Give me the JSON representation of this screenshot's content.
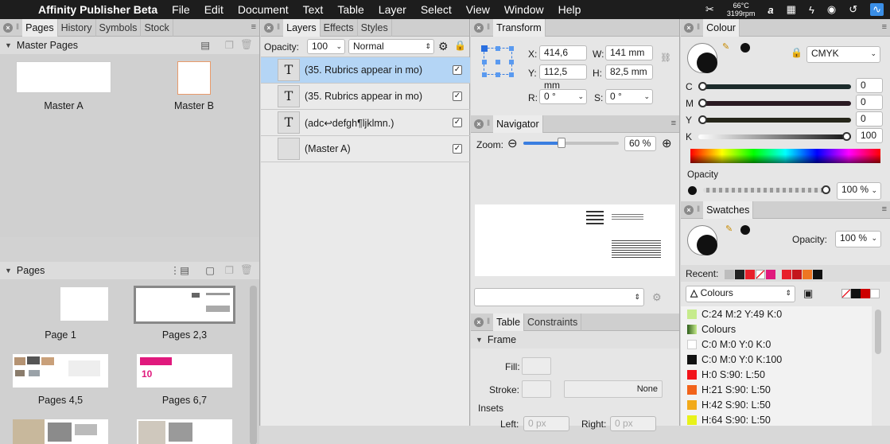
{
  "menubar": {
    "app_name": "Affinity Publisher Beta",
    "items": [
      "File",
      "Edit",
      "Document",
      "Text",
      "Table",
      "Layer",
      "Select",
      "View",
      "Window",
      "Help"
    ],
    "temperature": "66°C",
    "rpm": "3199rpm"
  },
  "pages_panel": {
    "tabs": [
      "Pages",
      "History",
      "Symbols",
      "Stock"
    ],
    "master_section": "Master Pages",
    "masters": [
      {
        "label": "Master A"
      },
      {
        "label": "Master B"
      }
    ],
    "pages_section": "Pages",
    "pages": [
      {
        "label": "Page 1"
      },
      {
        "label": "Pages 2,3"
      },
      {
        "label": "Pages 4,5"
      },
      {
        "label": "Pages 6,7"
      }
    ],
    "pages_6_7_mark": "10"
  },
  "layers_panel": {
    "tabs": [
      "Layers",
      "Effects",
      "Styles"
    ],
    "opacity_label": "Opacity:",
    "opacity_value": "100",
    "blend_mode": "Normal",
    "layers": [
      {
        "icon": "T",
        "label": "(35. Rubrics appear in  mo)",
        "checked": true
      },
      {
        "icon": "T",
        "label": "(35. Rubrics appear in  mo)",
        "checked": true
      },
      {
        "icon": "T",
        "label": "(adc↩defgh¶ljklmn.)",
        "checked": true
      },
      {
        "icon": "",
        "label": "(Master A)",
        "checked": true
      }
    ]
  },
  "transform_panel": {
    "tab": "Transform",
    "x_label": "X:",
    "x_value": "414,6",
    "y_label": "Y:",
    "y_value": "112,5 mm",
    "w_label": "W:",
    "w_value": "141 mm",
    "h_label": "H:",
    "h_value": "82,5 mm",
    "r_label": "R:",
    "r_value": "0 °",
    "s_label": "S:",
    "s_value": "0 °"
  },
  "navigator_panel": {
    "tab": "Navigator",
    "zoom_label": "Zoom:",
    "zoom_value": "60 %",
    "zoom_level": 0.4
  },
  "table_panel": {
    "tabs": [
      "Table",
      "Constraints"
    ],
    "frame_section": "Frame",
    "fill_label": "Fill:",
    "stroke_label": "Stroke:",
    "stroke_value": "None",
    "insets_label": "Insets",
    "left_label": "Left:",
    "left_value": "0 px",
    "right_label": "Right:",
    "right_value": "0 px"
  },
  "colour_panel": {
    "tab": "Colour",
    "model": "CMYK",
    "channels": [
      {
        "label": "C",
        "value": "0",
        "level": 0
      },
      {
        "label": "M",
        "value": "0",
        "level": 0
      },
      {
        "label": "Y",
        "value": "0",
        "level": 0
      },
      {
        "label": "K",
        "value": "100",
        "level": 1
      }
    ],
    "opacity_label": "Opacity",
    "opacity_value": "100 %",
    "opacity_level": 1
  },
  "swatches_panel": {
    "tab": "Swatches",
    "opacity_label": "Opacity:",
    "opacity_value": "100 %",
    "recent_label": "Recent:",
    "recent_colors": [
      "#bdbdbd",
      "#222222",
      "#e8202a",
      "none",
      "#e0197d",
      "#e8202a",
      "#c4161c",
      "#ee7623",
      "#111111"
    ],
    "palette": "Colours",
    "swatches": [
      {
        "label": "C:24 M:2 Y:49 K:0",
        "color": "#c6eb8b"
      },
      {
        "label": "Colours",
        "color": "gradient"
      },
      {
        "label": "C:0 M:0 Y:0 K:0",
        "color": "#ffffff"
      },
      {
        "label": "C:0 M:0 Y:0 K:100",
        "color": "#111111"
      },
      {
        "label": "H:0 S:90: L:50",
        "color": "#f2131a"
      },
      {
        "label": "H:21 S:90: L:50",
        "color": "#f2631a"
      },
      {
        "label": "H:42 S:90: L:50",
        "color": "#f2aa1a"
      },
      {
        "label": "H:64 S:90: L:50",
        "color": "#e8f21a"
      }
    ]
  }
}
